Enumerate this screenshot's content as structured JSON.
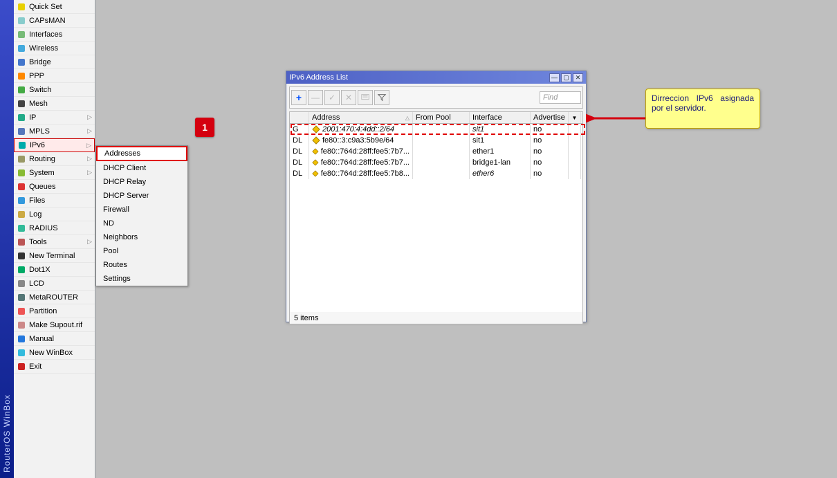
{
  "brand": "RouterOS WinBox",
  "sidebar": {
    "items": [
      {
        "label": "Quick Set",
        "arrow": false
      },
      {
        "label": "CAPsMAN",
        "arrow": false
      },
      {
        "label": "Interfaces",
        "arrow": false
      },
      {
        "label": "Wireless",
        "arrow": false
      },
      {
        "label": "Bridge",
        "arrow": false
      },
      {
        "label": "PPP",
        "arrow": false
      },
      {
        "label": "Switch",
        "arrow": false
      },
      {
        "label": "Mesh",
        "arrow": false
      },
      {
        "label": "IP",
        "arrow": true
      },
      {
        "label": "MPLS",
        "arrow": true
      },
      {
        "label": "IPv6",
        "arrow": true,
        "active": true
      },
      {
        "label": "Routing",
        "arrow": true
      },
      {
        "label": "System",
        "arrow": true
      },
      {
        "label": "Queues",
        "arrow": false
      },
      {
        "label": "Files",
        "arrow": false
      },
      {
        "label": "Log",
        "arrow": false
      },
      {
        "label": "RADIUS",
        "arrow": false
      },
      {
        "label": "Tools",
        "arrow": true
      },
      {
        "label": "New Terminal",
        "arrow": false
      },
      {
        "label": "Dot1X",
        "arrow": false
      },
      {
        "label": "LCD",
        "arrow": false
      },
      {
        "label": "MetaROUTER",
        "arrow": false
      },
      {
        "label": "Partition",
        "arrow": false
      },
      {
        "label": "Make Supout.rif",
        "arrow": false
      },
      {
        "label": "Manual",
        "arrow": false
      },
      {
        "label": "New WinBox",
        "arrow": false
      },
      {
        "label": "Exit",
        "arrow": false
      }
    ]
  },
  "submenu": {
    "items": [
      {
        "label": "Addresses",
        "highlight": true
      },
      {
        "label": "DHCP Client"
      },
      {
        "label": "DHCP Relay"
      },
      {
        "label": "DHCP Server"
      },
      {
        "label": "Firewall"
      },
      {
        "label": "ND"
      },
      {
        "label": "Neighbors"
      },
      {
        "label": "Pool"
      },
      {
        "label": "Routes"
      },
      {
        "label": "Settings"
      }
    ]
  },
  "window": {
    "title": "IPv6 Address List",
    "find_placeholder": "Find",
    "columns": {
      "flag": "",
      "address": "Address",
      "pool": "From Pool",
      "iface": "Interface",
      "adv": "Advertise"
    },
    "rows": [
      {
        "flags": "G",
        "address": "2001:470:4:4dd::2/64",
        "pool": "",
        "iface": "sit1",
        "adv": "no",
        "italic": true
      },
      {
        "flags": "DL",
        "address": "fe80::3:c9a3:5b9e/64",
        "pool": "",
        "iface": "sit1",
        "adv": "no"
      },
      {
        "flags": "DL",
        "address": "fe80::764d:28ff:fee5:7b7...",
        "pool": "",
        "iface": "ether1",
        "adv": "no"
      },
      {
        "flags": "DL",
        "address": "fe80::764d:28ff:fee5:7b7...",
        "pool": "",
        "iface": "bridge1-lan",
        "adv": "no"
      },
      {
        "flags": "DL",
        "address": "fe80::764d:28ff:fee5:7b8...",
        "pool": "",
        "iface": "ether6",
        "adv": "no",
        "iface_italic": true
      }
    ],
    "status": "5 items"
  },
  "annotation": {
    "marker": "1",
    "callout": "Dirreccion IPv6 asignada por el servidor."
  }
}
